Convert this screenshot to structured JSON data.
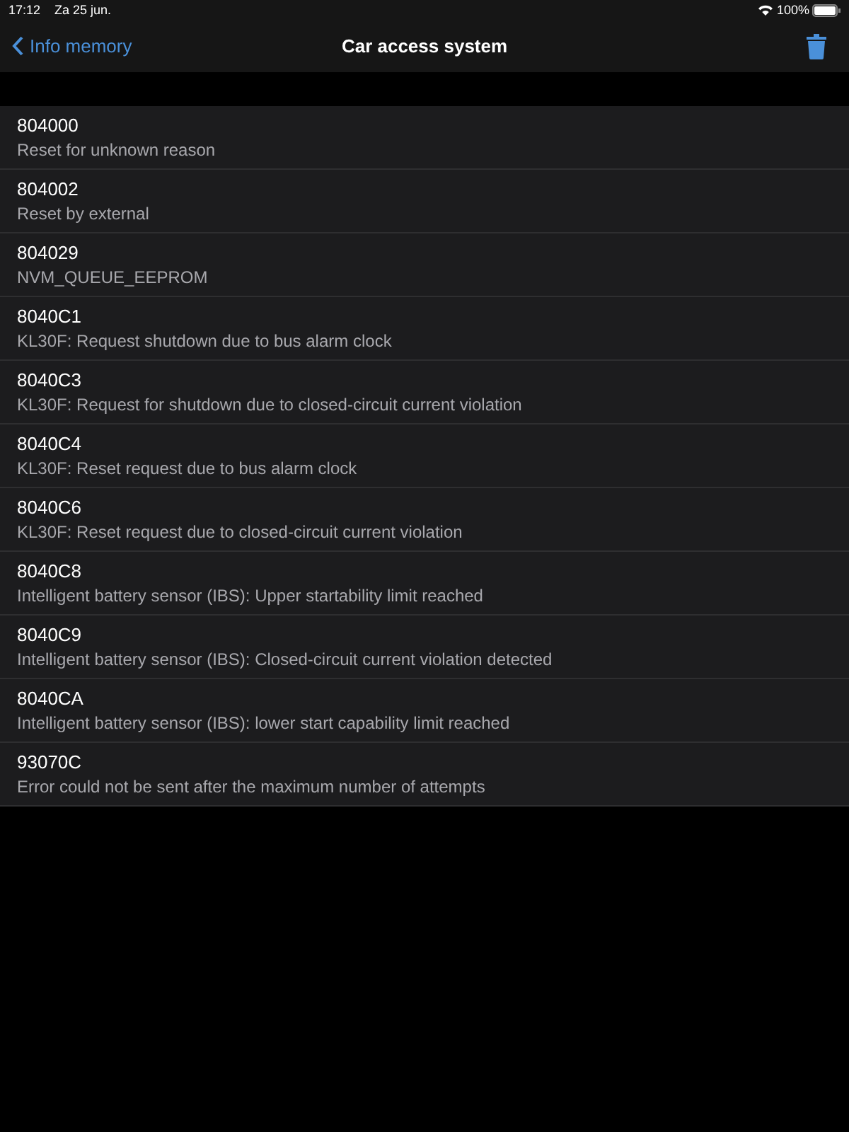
{
  "status_bar": {
    "time": "17:12",
    "date": "Za 25 jun.",
    "battery": "100%"
  },
  "nav": {
    "back": "Info memory",
    "title": "Car access system"
  },
  "entries": [
    {
      "code": "804000",
      "description": "Reset for unknown reason"
    },
    {
      "code": "804002",
      "description": "Reset by external"
    },
    {
      "code": "804029",
      "description": "NVM_QUEUE_EEPROM"
    },
    {
      "code": "8040C1",
      "description": "KL30F: Request shutdown due to bus alarm clock"
    },
    {
      "code": "8040C3",
      "description": "KL30F: Request for shutdown due to closed-circuit current violation"
    },
    {
      "code": "8040C4",
      "description": "KL30F: Reset request due to bus alarm clock"
    },
    {
      "code": "8040C6",
      "description": "KL30F: Reset request due to closed-circuit current violation"
    },
    {
      "code": "8040C8",
      "description": "Intelligent battery sensor (IBS): Upper startability limit reached"
    },
    {
      "code": "8040C9",
      "description": "Intelligent battery sensor (IBS): Closed-circuit current violation detected"
    },
    {
      "code": "8040CA",
      "description": "Intelligent battery sensor (IBS): lower start capability limit reached"
    },
    {
      "code": "93070C",
      "description": "Error could not be sent after the maximum number of attempts"
    }
  ]
}
